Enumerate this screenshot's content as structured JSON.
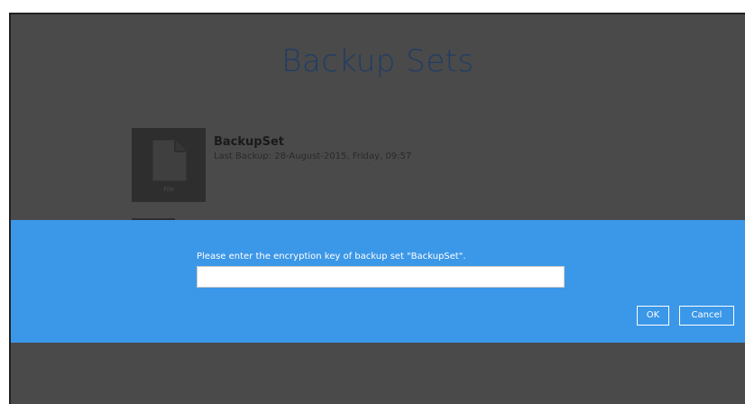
{
  "main": {
    "title": "Backup Sets",
    "backup_sets": [
      {
        "name": "BackupSet",
        "last_backup": "Last Backup: 28-August-2015, Friday, 09:57",
        "tile_caption": "File",
        "icon": "file-icon"
      }
    ]
  },
  "dialog": {
    "prompt": "Please enter the encryption key of backup set \"BackupSet\".",
    "key_value": "",
    "ok_label": "OK",
    "cancel_label": "Cancel",
    "background_color": "#3b97e8"
  },
  "colors": {
    "overlay_background": "#4a4a4a",
    "title_color": "#1f3d66",
    "tile_background": "#2e2e2e"
  }
}
